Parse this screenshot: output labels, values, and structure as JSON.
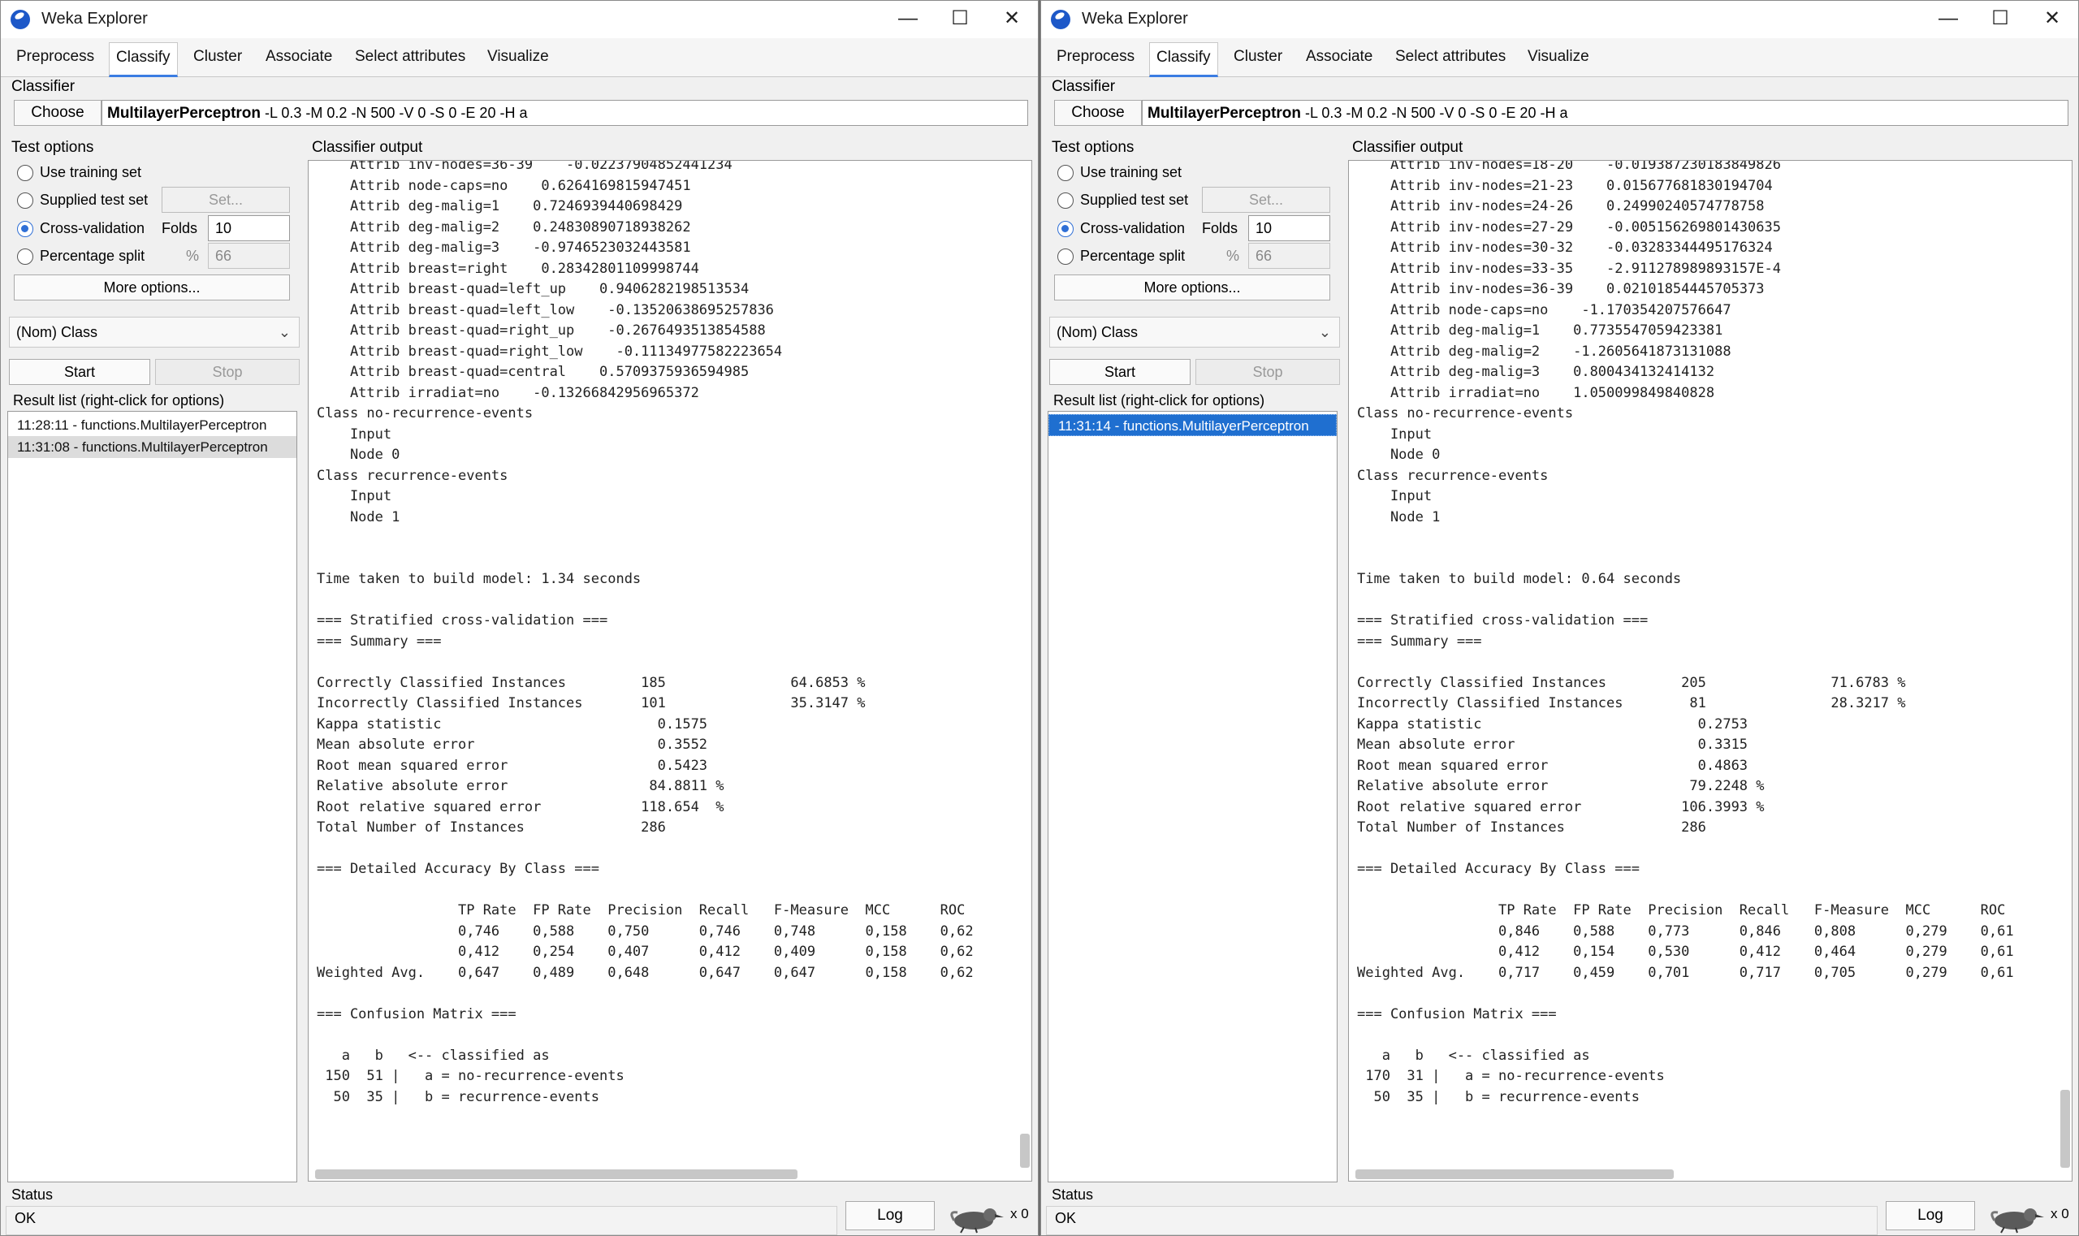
{
  "common": {
    "app_title": "Weka Explorer",
    "tabs": [
      "Preprocess",
      "Classify",
      "Cluster",
      "Associate",
      "Select attributes",
      "Visualize"
    ],
    "classifier_label": "Classifier",
    "choose_label": "Choose",
    "classifier_name": "MultilayerPerceptron",
    "classifier_args": " -L 0.3 -M 0.2 -N 500 -V 0 -S 0 -E 20 -H a",
    "test_options_label": "Test options",
    "use_training_set": "Use training set",
    "supplied_test_set": "Supplied test set",
    "set_button": "Set...",
    "cross_validation": "Cross-validation",
    "folds_label": "Folds",
    "folds_value": "10",
    "percentage_split": "Percentage split",
    "percent_symbol": "%",
    "percent_value": "66",
    "more_options": "More options...",
    "nom_class": "(Nom) Class",
    "start": "Start",
    "stop": "Stop",
    "result_list_label": "Result list (right-click for options)",
    "classifier_output_label": "Classifier output",
    "status_label": "Status",
    "status_value": "OK",
    "log_button": "Log",
    "x_count": "x 0"
  },
  "window1": {
    "results": [
      "11:28:11 - functions.MultilayerPerceptron",
      "11:31:08 - functions.MultilayerPerceptron"
    ],
    "output_lines": [
      "    Attrib inv-nodes=36-39    -0.02237904852441234",
      "    Attrib node-caps=no    0.6264169815947451",
      "    Attrib deg-malig=1    0.7246939440698429",
      "    Attrib deg-malig=2    0.24830890718938262",
      "    Attrib deg-malig=3    -0.9746523032443581",
      "    Attrib breast=right    0.28342801109998744",
      "    Attrib breast-quad=left_up    0.9406282198513534",
      "    Attrib breast-quad=left_low    -0.13520638695257836",
      "    Attrib breast-quad=right_up    -0.2676493513854588",
      "    Attrib breast-quad=right_low    -0.11134977582223654",
      "    Attrib breast-quad=central    0.5709375936594985",
      "    Attrib irradiat=no    -0.13266842956965372",
      "Class no-recurrence-events",
      "    Input",
      "    Node 0",
      "Class recurrence-events",
      "    Input",
      "    Node 1",
      "",
      "",
      "Time taken to build model: 1.34 seconds",
      "",
      "=== Stratified cross-validation ===",
      "=== Summary ===",
      "",
      "Correctly Classified Instances         185               64.6853 %",
      "Incorrectly Classified Instances       101               35.3147 %",
      "Kappa statistic                          0.1575",
      "Mean absolute error                      0.3552",
      "Root mean squared error                  0.5423",
      "Relative absolute error                 84.8811 %",
      "Root relative squared error            118.654  %",
      "Total Number of Instances              286",
      "",
      "=== Detailed Accuracy By Class ===",
      "",
      "                 TP Rate  FP Rate  Precision  Recall   F-Measure  MCC      ROC",
      "                 0,746    0,588    0,750      0,746    0,748      0,158    0,62",
      "                 0,412    0,254    0,407      0,412    0,409      0,158    0,62",
      "Weighted Avg.    0,647    0,489    0,648      0,647    0,647      0,158    0,62",
      "",
      "=== Confusion Matrix ===",
      "",
      "   a   b   <-- classified as",
      " 150  51 |   a = no-recurrence-events",
      "  50  35 |   b = recurrence-events"
    ]
  },
  "window2": {
    "results": [
      "11:31:14 - functions.MultilayerPerceptron"
    ],
    "output_lines": [
      "    Attrib inv-nodes=18-20    -0.019387230183849826",
      "    Attrib inv-nodes=21-23    0.015677681830194704",
      "    Attrib inv-nodes=24-26    0.24990240574778758",
      "    Attrib inv-nodes=27-29    -0.005156269801430635",
      "    Attrib inv-nodes=30-32    -0.03283344495176324",
      "    Attrib inv-nodes=33-35    -2.911278989893157E-4",
      "    Attrib inv-nodes=36-39    0.02101854445705373",
      "    Attrib node-caps=no    -1.170354207576647",
      "    Attrib deg-malig=1    0.7735547059423381",
      "    Attrib deg-malig=2    -1.2605641873131088",
      "    Attrib deg-malig=3    0.800434132414132",
      "    Attrib irradiat=no    1.050099849840828",
      "Class no-recurrence-events",
      "    Input",
      "    Node 0",
      "Class recurrence-events",
      "    Input",
      "    Node 1",
      "",
      "",
      "Time taken to build model: 0.64 seconds",
      "",
      "=== Stratified cross-validation ===",
      "=== Summary ===",
      "",
      "Correctly Classified Instances         205               71.6783 %",
      "Incorrectly Classified Instances        81               28.3217 %",
      "Kappa statistic                          0.2753",
      "Mean absolute error                      0.3315",
      "Root mean squared error                  0.4863",
      "Relative absolute error                 79.2248 %",
      "Root relative squared error            106.3993 %",
      "Total Number of Instances              286",
      "",
      "=== Detailed Accuracy By Class ===",
      "",
      "                 TP Rate  FP Rate  Precision  Recall   F-Measure  MCC      ROC",
      "                 0,846    0,588    0,773      0,846    0,808      0,279    0,61",
      "                 0,412    0,154    0,530      0,412    0,464      0,279    0,61",
      "Weighted Avg.    0,717    0,459    0,701      0,717    0,705      0,279    0,61",
      "",
      "=== Confusion Matrix ===",
      "",
      "   a   b   <-- classified as",
      " 170  31 |   a = no-recurrence-events",
      "  50  35 |   b = recurrence-events"
    ]
  }
}
